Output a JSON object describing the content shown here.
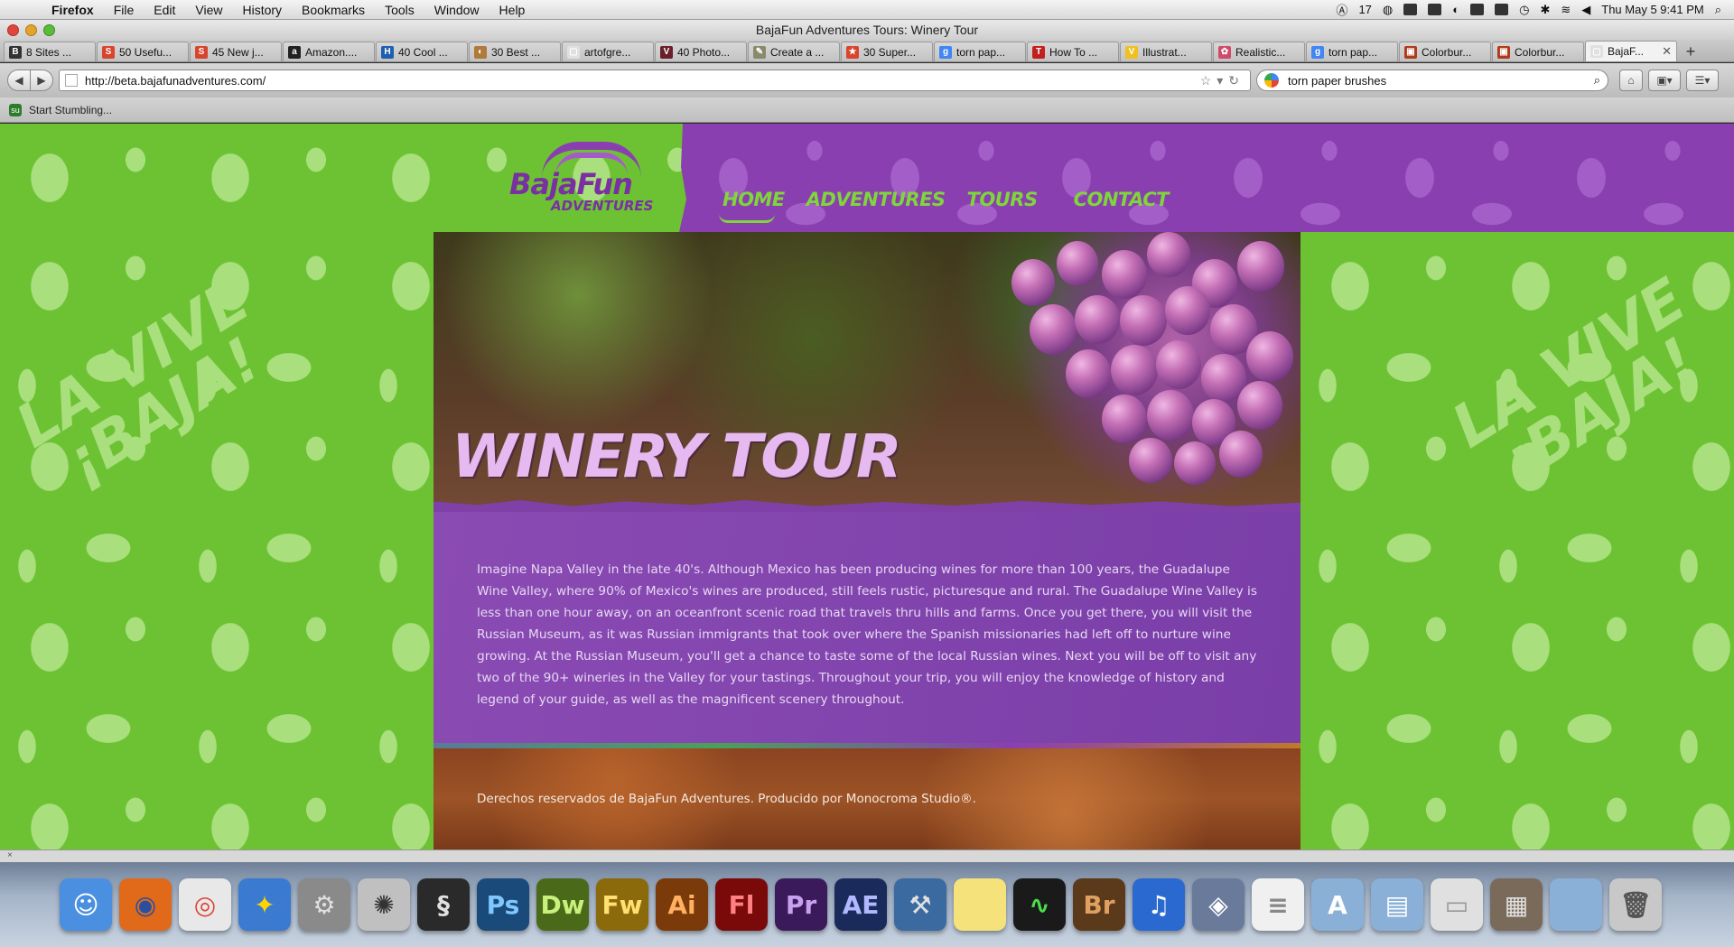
{
  "menubar": {
    "app_name": "Firefox",
    "items": [
      "File",
      "Edit",
      "View",
      "History",
      "Bookmarks",
      "Tools",
      "Window",
      "Help"
    ],
    "adobe_count": "17",
    "clock": "Thu May 5  9:41 PM"
  },
  "window": {
    "title": "BajaFun Adventures Tours: Winery Tour"
  },
  "tabs": [
    {
      "label": "8 Sites ...",
      "icon": "B",
      "color": "#333333"
    },
    {
      "label": "50 Usefu...",
      "icon": "S",
      "color": "#d9442c"
    },
    {
      "label": "45 New j...",
      "icon": "S",
      "color": "#d9442c"
    },
    {
      "label": "Amazon....",
      "icon": "a",
      "color": "#222222"
    },
    {
      "label": "40 Cool ...",
      "icon": "H",
      "color": "#1f5fb0"
    },
    {
      "label": "30 Best ...",
      "icon": "◐",
      "color": "#b07a3a"
    },
    {
      "label": "artofgre...",
      "icon": "▢",
      "color": "#e0e0e0"
    },
    {
      "label": "40 Photo...",
      "icon": "V",
      "color": "#6a1f2a"
    },
    {
      "label": "Create a ...",
      "icon": "✎",
      "color": "#8a8a6a"
    },
    {
      "label": "30 Super...",
      "icon": "★",
      "color": "#d9442c"
    },
    {
      "label": "torn pap...",
      "icon": "g",
      "color": "#4285f4"
    },
    {
      "label": "How To ...",
      "icon": "T",
      "color": "#c41f1f"
    },
    {
      "label": "Illustrat...",
      "icon": "V",
      "color": "#f0c020"
    },
    {
      "label": "Realistic...",
      "icon": "✿",
      "color": "#d04a6a"
    },
    {
      "label": "torn pap...",
      "icon": "g",
      "color": "#4285f4"
    },
    {
      "label": "Colorbur...",
      "icon": "▣",
      "color": "#b03a1a"
    },
    {
      "label": "Colorbur...",
      "icon": "▣",
      "color": "#b03a1a"
    },
    {
      "label": "BajaF...",
      "icon": "▢",
      "color": "#e0e0e0",
      "active": true
    }
  ],
  "nav": {
    "url": "http://beta.bajafunadventures.com/",
    "search_value": "torn paper brushes"
  },
  "bookmarks_bar": {
    "stumble_label": "Start Stumbling..."
  },
  "site": {
    "logo_main": "BajaFun",
    "logo_sub": "ADVENTURES",
    "menu": [
      "HOME",
      "ADVENTURES",
      "TOURS",
      "CONTACT"
    ],
    "side_tagline_line1": "LA VIVE",
    "side_tagline_line2": "¡BAJA!",
    "hero_title": "WINERY TOUR",
    "body": "Imagine Napa Valley in the late 40's. Although Mexico has been producing wines for more than 100 years, the Guadalupe Wine Valley, where 90% of Mexico's wines are produced, still feels rustic, picturesque and rural. The Guadalupe Wine Valley is less than one hour away, on an oceanfront scenic road that travels thru hills and farms. Once you get there, you will visit the Russian Museum, as it was Russian immigrants that took over where the Spanish missionaries had left off to nurture wine growing. At the Russian Museum, you'll get a chance to taste some of the local Russian wines. Next you will be off to visit any two of the 90+ wineries in the Valley for your tastings. Throughout your trip, you will enjoy the knowledge of history and legend of your guide, as well as the magnificent scenery throughout.",
    "footer": "Derechos reservados de BajaFun Adventures. Producido por Monocroma Studio®."
  },
  "dock": [
    {
      "icon": "finder-icon",
      "label": "☺",
      "bg": "#4a8fe0",
      "fg": "#ffffff"
    },
    {
      "icon": "firefox-icon",
      "label": "◉",
      "bg": "#e06a1a",
      "fg": "#2a4fa0"
    },
    {
      "icon": "chrome-icon",
      "label": "◎",
      "bg": "#e8e8e8",
      "fg": "#db4437"
    },
    {
      "icon": "tweetie-icon",
      "label": "✦",
      "bg": "#3a7ad0",
      "fg": "#ffd400"
    },
    {
      "icon": "system-prefs-icon",
      "label": "⚙",
      "bg": "#8a8a8a",
      "fg": "#e0e0e0"
    },
    {
      "icon": "zbrush-icon",
      "label": "✺",
      "bg": "#c0c0c0",
      "fg": "#333333"
    },
    {
      "icon": "maya-icon",
      "label": "§",
      "bg": "#2a2a2a",
      "fg": "#e0e0e0"
    },
    {
      "icon": "photoshop-icon",
      "label": "Ps",
      "bg": "#1a4a7a",
      "fg": "#7fc8ff"
    },
    {
      "icon": "dreamweaver-icon",
      "label": "Dw",
      "bg": "#4a6a1a",
      "fg": "#c8f07a"
    },
    {
      "icon": "fireworks-icon",
      "label": "Fw",
      "bg": "#8a6a0a",
      "fg": "#ffe070"
    },
    {
      "icon": "illustrator-icon",
      "label": "Ai",
      "bg": "#7a3a0a",
      "fg": "#ffb060"
    },
    {
      "icon": "flash-icon",
      "label": "Fl",
      "bg": "#7a0a0a",
      "fg": "#ff8080"
    },
    {
      "icon": "premiere-icon",
      "label": "Pr",
      "bg": "#3a1a5a",
      "fg": "#c8a0f0"
    },
    {
      "icon": "after-effects-icon",
      "label": "AE",
      "bg": "#1a2a5a",
      "fg": "#b0b8ff"
    },
    {
      "icon": "xcode-icon",
      "label": "⚒",
      "bg": "#3a6aa0",
      "fg": "#e0e0e0"
    },
    {
      "icon": "stickies-icon",
      "label": " ",
      "bg": "#f5e27a",
      "fg": "#333333"
    },
    {
      "icon": "activity-monitor-icon",
      "label": "∿",
      "bg": "#1a1a1a",
      "fg": "#4ae04a"
    },
    {
      "icon": "bridge-icon",
      "label": "Br",
      "bg": "#5a3a1a",
      "fg": "#e0a060"
    },
    {
      "icon": "itunes-icon",
      "label": "♫",
      "bg": "#2a6ad0",
      "fg": "#ffffff"
    },
    {
      "icon": "preview-icon",
      "label": "◈",
      "bg": "#6a7a9a",
      "fg": "#ffffff"
    },
    {
      "icon": "pdf-document-icon",
      "label": "≡",
      "bg": "#f0f0f0",
      "fg": "#888888"
    },
    {
      "icon": "applications-folder-icon",
      "label": "A",
      "bg": "#8ab0d8",
      "fg": "#ffffff"
    },
    {
      "icon": "documents-folder-icon",
      "label": "▤",
      "bg": "#8ab0d8",
      "fg": "#ffffff"
    },
    {
      "icon": "drive-icon",
      "label": "▭",
      "bg": "#e0e0e0",
      "fg": "#999999"
    },
    {
      "icon": "image-stack-icon",
      "label": "▦",
      "bg": "#7a6a5a",
      "fg": "#e0e0e0"
    },
    {
      "icon": "downloads-folder-icon",
      "label": " ",
      "bg": "#8ab0d8",
      "fg": "#ffffff"
    },
    {
      "icon": "trash-icon",
      "label": "🗑",
      "bg": "#c8c8c8",
      "fg": "#555555"
    }
  ]
}
